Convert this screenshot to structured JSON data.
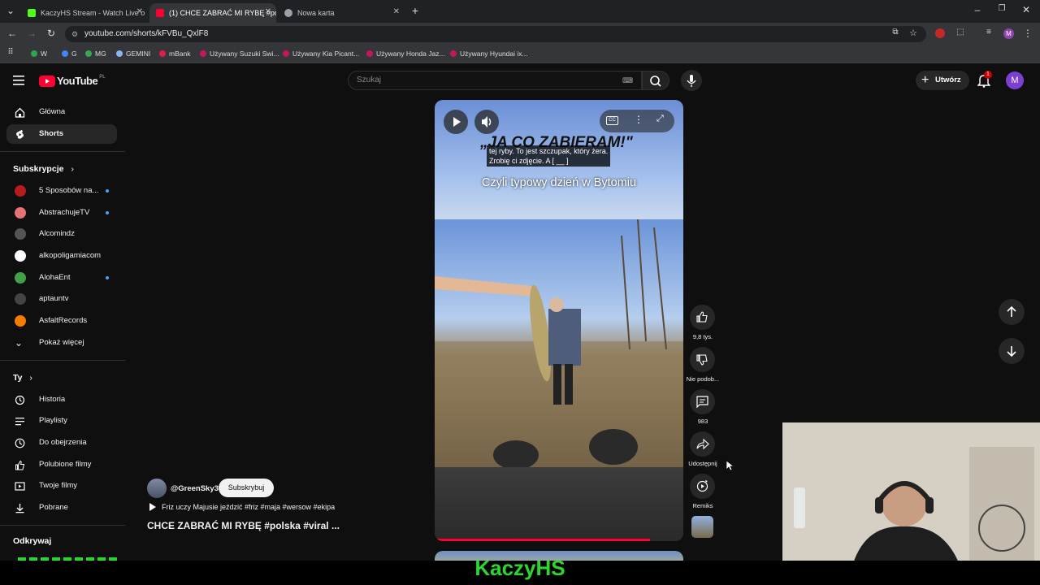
{
  "browser": {
    "tabs": [
      {
        "title": "KaczyHS Stream - Watch Live o",
        "active": false,
        "icon_color": "#53fc18"
      },
      {
        "title": "(1) CHCE ZABRAĆ MI RYBĘ #po",
        "active": true,
        "icon_color": "#ff0033"
      },
      {
        "title": "Nowa karta",
        "active": false,
        "icon_color": "#9aa0a6"
      }
    ],
    "new_tab_icon": "plus-icon",
    "url": "youtube.com/shorts/kFVBu_QxlF8",
    "bookmarks": [
      {
        "label": "W",
        "color": "#2ea44f"
      },
      {
        "label": "G",
        "color": "#4285f4"
      },
      {
        "label": "MG",
        "color": "#34a853"
      },
      {
        "label": "GEMINI",
        "color": "#8ab4f8"
      },
      {
        "label": "mBank",
        "color": "#e11d48"
      },
      {
        "label": "Używany Suzuki Swi...",
        "color": "#c2185b"
      },
      {
        "label": "Używany Kia Picant...",
        "color": "#c2185b"
      },
      {
        "label": "Używany Honda Jaz...",
        "color": "#c2185b"
      },
      {
        "label": "Używany Hyundai ix...",
        "color": "#c2185b"
      }
    ]
  },
  "youtube": {
    "logo_text": "YouTube",
    "logo_region": "PL",
    "search_placeholder": "Szukaj",
    "create_label": "Utwórz",
    "notification_count": "1",
    "account_initial": "M",
    "sidebar": {
      "main": [
        {
          "label": "Główna",
          "icon": "home-icon",
          "active": false
        },
        {
          "label": "Shorts",
          "icon": "shorts-icon",
          "active": true
        }
      ],
      "subscriptions_title": "Subskrypcje",
      "subscriptions": [
        {
          "label": "5 Sposobów na...",
          "color": "#b71c1c",
          "new": true
        },
        {
          "label": "AbstrachujeTV",
          "color": "#e57373",
          "new": true
        },
        {
          "label": "Alcomindz",
          "color": "#555555",
          "new": false
        },
        {
          "label": "alkopoligamiacom",
          "color": "#ffffff",
          "new": false
        },
        {
          "label": "AlohaEnt",
          "color": "#43a047",
          "new": true
        },
        {
          "label": "aptauntv",
          "color": "#444444",
          "new": false
        },
        {
          "label": "AsfaltRecords",
          "color": "#f57c00",
          "new": false
        }
      ],
      "show_more": "Pokaż więcej",
      "you_title": "Ty",
      "you_items": [
        {
          "label": "Historia",
          "icon": "history-icon"
        },
        {
          "label": "Playlisty",
          "icon": "playlist-icon"
        },
        {
          "label": "Do obejrzenia",
          "icon": "clock-icon"
        },
        {
          "label": "Polubione filmy",
          "icon": "thumbs-up-icon"
        },
        {
          "label": "Twoje filmy",
          "icon": "play-box-icon"
        },
        {
          "label": "Pobrane",
          "icon": "download-icon"
        }
      ],
      "explore_title": "Odkrywaj"
    },
    "short": {
      "overlay_text": "„JA CO ZABIERAM!\"",
      "subtitle_line1": "tej ryby. To jest szczupak, który żera.",
      "subtitle_line2": "Zrobię ci zdjęcie. A [ __ ]",
      "caption": "Czyli typowy dzień w Bytomiu",
      "progress": 0.85,
      "channel": "@GreenSky3",
      "subscribe_label": "Subskrybuj",
      "playlist_line": "Friz uczy Majusie jeździć #friz #maja #wersow #ekipa",
      "title": "CHCE ZABRAĆ MI RYBĘ #polska #viral ..."
    },
    "actions": [
      {
        "label": "9,8 tys.",
        "icon": "thumbs-up-icon"
      },
      {
        "label": "Nie podob...",
        "icon": "thumbs-down-icon"
      },
      {
        "label": "983",
        "icon": "comment-icon"
      },
      {
        "label": "Udostępnij",
        "icon": "share-icon"
      },
      {
        "label": "Remiks",
        "icon": "remix-icon"
      }
    ]
  },
  "stream": {
    "streamer_name": "KaczyHS"
  }
}
